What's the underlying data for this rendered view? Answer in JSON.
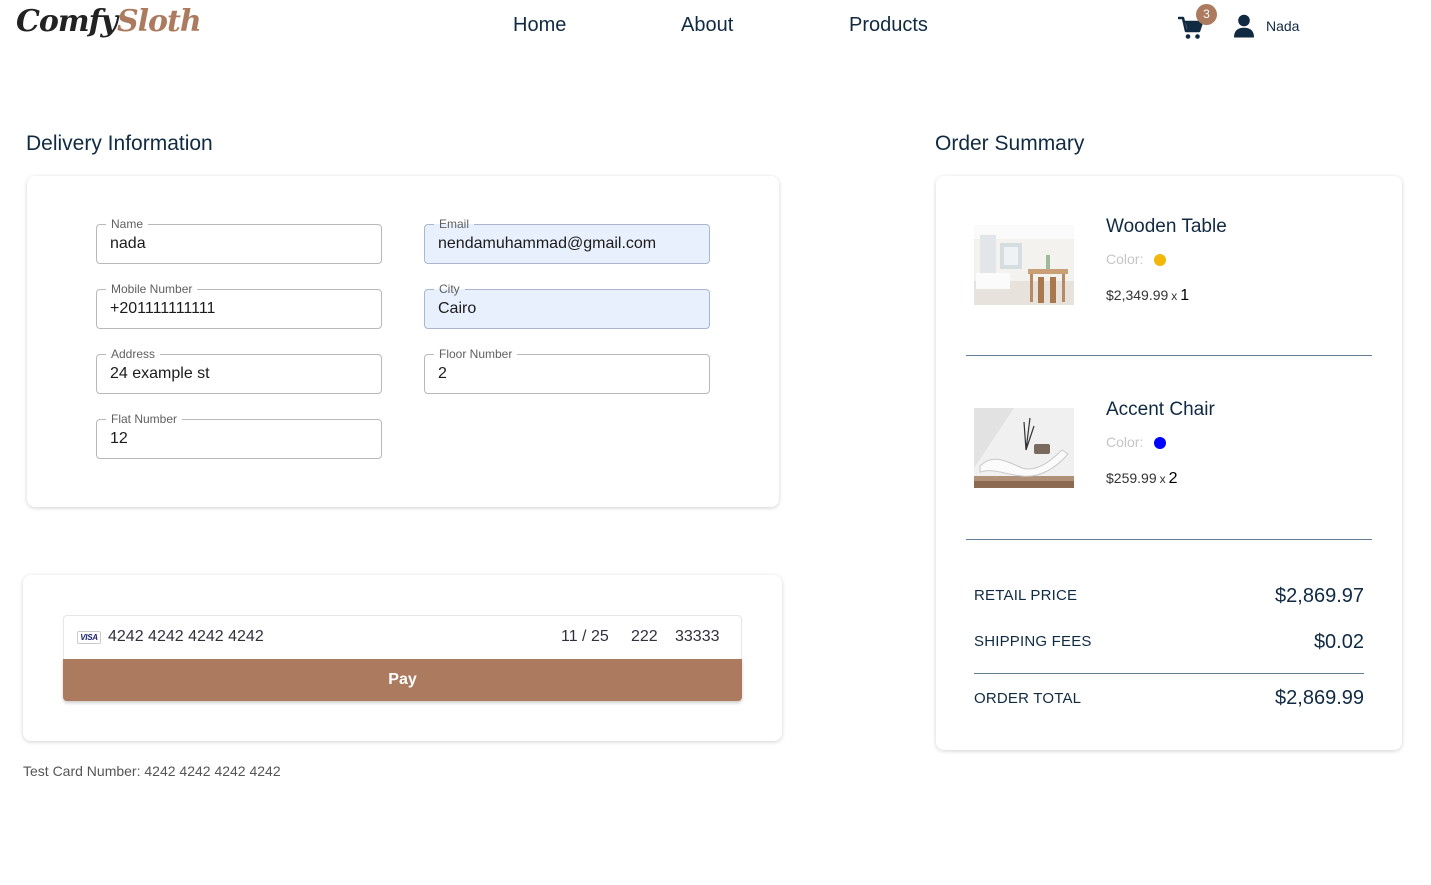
{
  "nav": {
    "logo_part1": "Comfy",
    "logo_part2": "Sloth",
    "links": [
      "Home",
      "About",
      "Products"
    ],
    "cart_count": "3",
    "user_name": "Nada"
  },
  "delivery": {
    "title": "Delivery Information",
    "fields": {
      "name": {
        "label": "Name",
        "value": "nada"
      },
      "email": {
        "label": "Email",
        "value": "nendamuhammad@gmail.com"
      },
      "mobile": {
        "label": "Mobile Number",
        "value": "+201111111111"
      },
      "city": {
        "label": "City",
        "value": "Cairo"
      },
      "address": {
        "label": "Address",
        "value": "24 example st"
      },
      "floor": {
        "label": "Floor Number",
        "value": "2"
      },
      "flat": {
        "label": "Flat Number",
        "value": "12"
      }
    }
  },
  "payment": {
    "card_brand": "VISA",
    "card_number": "4242 4242 4242 4242",
    "expiry": "11 / 25",
    "cvc": "222",
    "zip": "33333",
    "pay_label": "Pay",
    "test_note": "Test Card Number: 4242 4242 4242 4242"
  },
  "summary": {
    "title": "Order Summary",
    "color_label": "Color:",
    "x_label": "x",
    "items": [
      {
        "name": "Wooden Table",
        "color": "#f5b60a",
        "price": "$2,349.99",
        "qty": "1"
      },
      {
        "name": "Accent Chair",
        "color": "#0000ff",
        "price": "$259.99",
        "qty": "2"
      }
    ],
    "retail_label": "RETAIL PRICE",
    "retail_value": "$2,869.97",
    "shipping_label": "SHIPPING FEES",
    "shipping_value": "$0.02",
    "total_label": "ORDER TOTAL",
    "total_value": "$2,869.99"
  },
  "colors": {
    "primary": "#ab7a5f",
    "text": "#102a42",
    "autofill": "#e8f0fe"
  }
}
